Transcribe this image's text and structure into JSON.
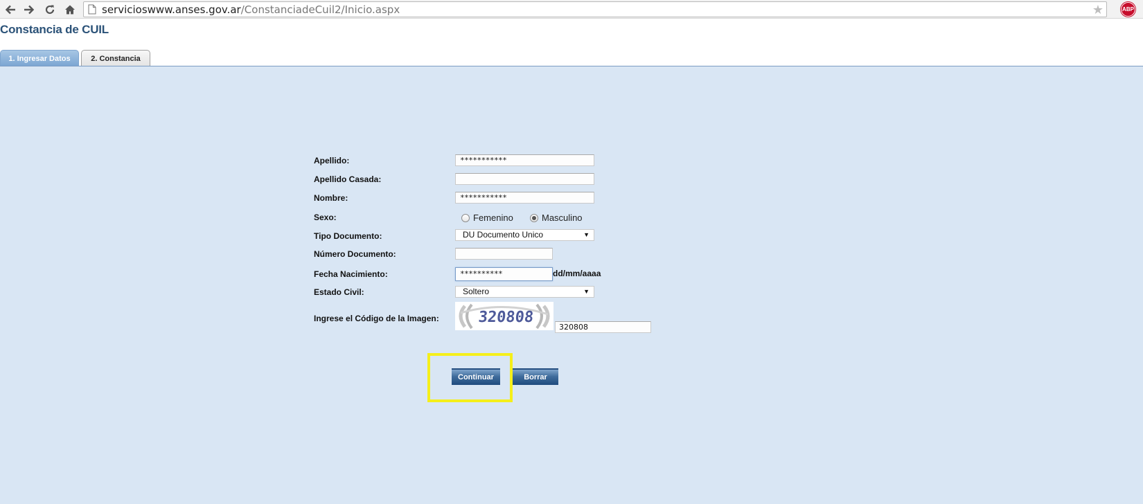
{
  "browser": {
    "url_host": "servicioswww.anses.gov.ar",
    "url_path": "/ConstanciadeCuil2/Inicio.aspx",
    "adblock_label": "ABP",
    "icons": [
      "back-arrow-icon",
      "forward-arrow-icon",
      "reload-icon",
      "home-icon",
      "page-icon",
      "bookmark-star-icon"
    ]
  },
  "page": {
    "title": "Constancia de CUIL",
    "tabs": [
      {
        "label": "1. Ingresar Datos",
        "active": true
      },
      {
        "label": "2. Constancia",
        "active": false
      }
    ]
  },
  "form": {
    "apellido": {
      "label": "Apellido:",
      "value": "***********"
    },
    "apellido_casada": {
      "label": "Apellido Casada:",
      "value": ""
    },
    "nombre": {
      "label": "Nombre:",
      "value": "***********"
    },
    "sexo": {
      "label": "Sexo:",
      "options": [
        {
          "label": "Femenino",
          "selected": false
        },
        {
          "label": "Masculino",
          "selected": true
        }
      ]
    },
    "tipo_documento": {
      "label": "Tipo Documento:",
      "value": "DU Documento Unico"
    },
    "numero_documento": {
      "label": "Número Documento:",
      "value": ""
    },
    "fecha_nacimiento": {
      "label": "Fecha Nacimiento:",
      "value": "**********",
      "hint": "dd/mm/aaaa"
    },
    "estado_civil": {
      "label": "Estado Civil:",
      "value": "Soltero"
    },
    "captcha": {
      "label": "Ingrese el Código de la Imagen:",
      "image_text": "320808",
      "value": "320808"
    }
  },
  "buttons": {
    "continuar": "Continuar",
    "borrar": "Borrar"
  },
  "colors": {
    "content_bg": "#d9e6f4",
    "title": "#2b5278",
    "highlight": "#f5ef1a",
    "button": "#3f6c9c"
  }
}
